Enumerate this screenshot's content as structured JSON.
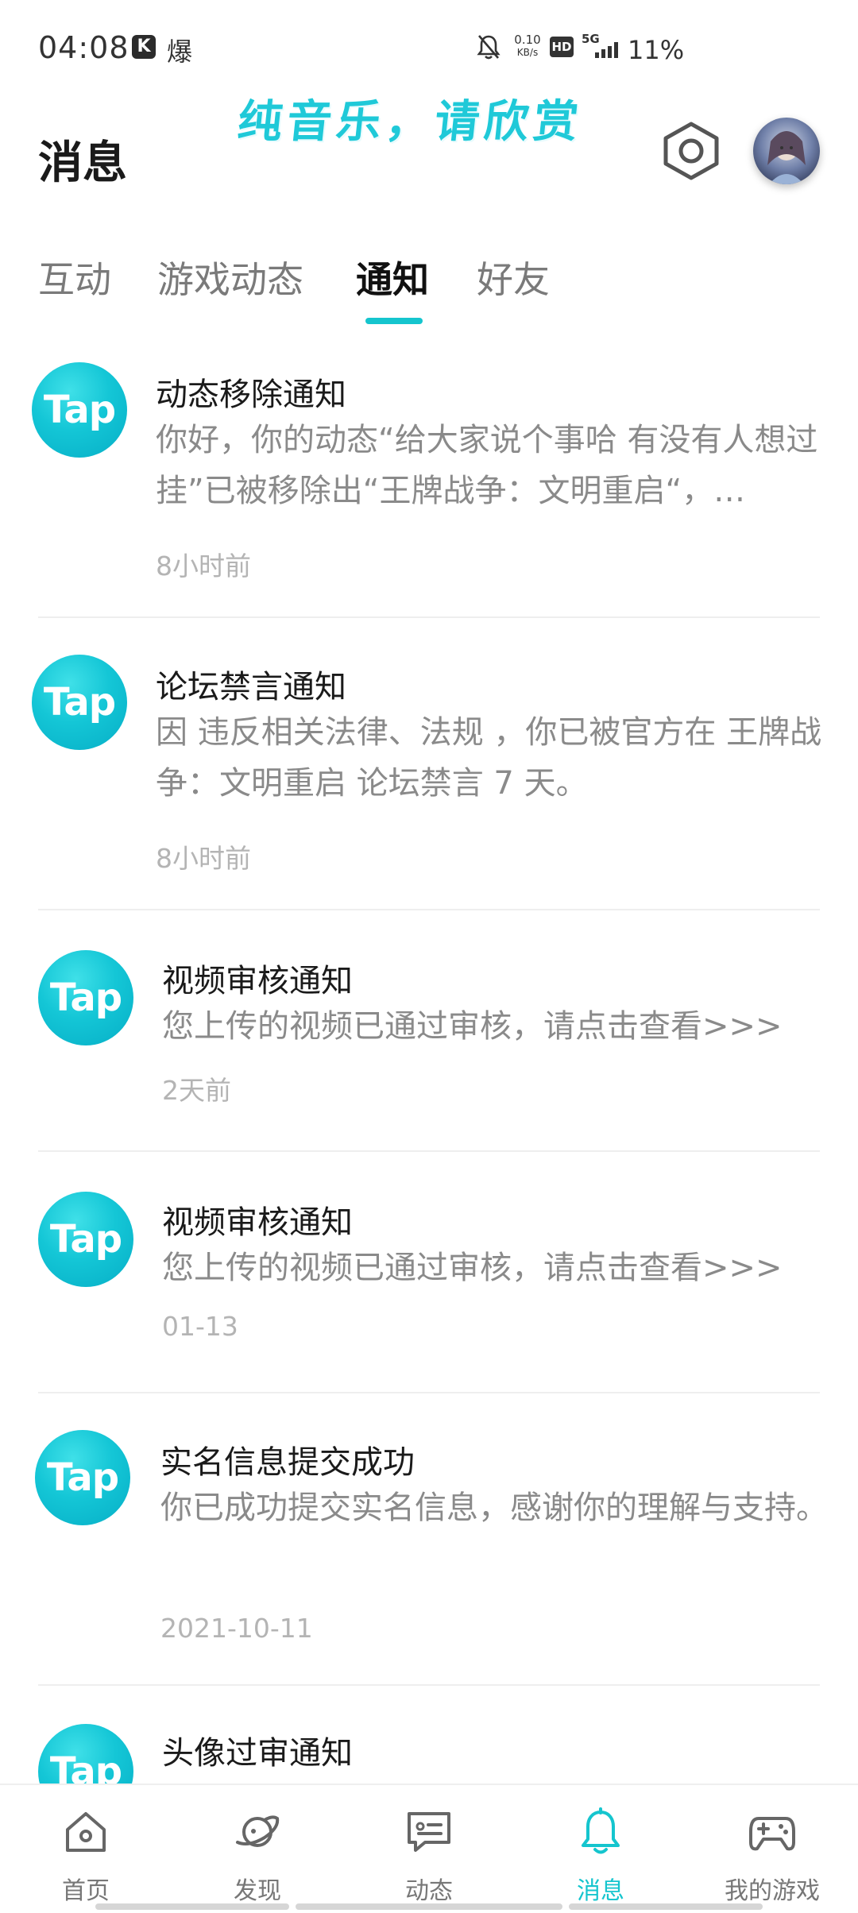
{
  "status_bar": {
    "time": "04:08",
    "app_icon_k": "K",
    "app_icon_2": "爆",
    "net_speed_value": "0.10",
    "net_speed_unit": "KB/s",
    "hd_badge": "HD",
    "network_type": "5G",
    "battery": "11%"
  },
  "overlay_caption": "纯音乐，请欣赏",
  "header": {
    "title": "消息"
  },
  "tabs": [
    {
      "label": "互动"
    },
    {
      "label": "游戏动态"
    },
    {
      "label": "通知"
    },
    {
      "label": "好友"
    }
  ],
  "active_tab_index": 2,
  "notifications": [
    {
      "logo": "Tap",
      "title": "动态移除通知",
      "body": "你好，你的动态“给大家说个事哈 有没有人想过挂”已被移除出“王牌战争：文明重启“，…",
      "time": "8小时前"
    },
    {
      "logo": "Tap",
      "title": "论坛禁言通知",
      "body": "因 违反相关法律、法规 ，你已被官方在 王牌战争：文明重启 论坛禁言 7 天。",
      "time": "8小时前"
    },
    {
      "logo": "Tap",
      "title": "视频审核通知",
      "body": "您上传的视频已通过审核，请点击查看>>>",
      "time": "2天前"
    },
    {
      "logo": "Tap",
      "title": "视频审核通知",
      "body": "您上传的视频已通过审核，请点击查看>>>",
      "time": "01-13"
    },
    {
      "logo": "Tap",
      "title": "实名信息提交成功",
      "body": "你已成功提交实名信息，感谢你的理解与支持。",
      "time": "2021-10-11"
    },
    {
      "logo": "Tap",
      "title": "头像过审通知",
      "body": "",
      "time": ""
    }
  ],
  "bottom_nav": [
    {
      "label": "首页",
      "icon": "home-icon"
    },
    {
      "label": "发现",
      "icon": "planet-icon"
    },
    {
      "label": "动态",
      "icon": "chat-icon"
    },
    {
      "label": "消息",
      "icon": "bell-icon"
    },
    {
      "label": "我的游戏",
      "icon": "gamepad-icon"
    }
  ],
  "colors": {
    "accent": "#15c5ce",
    "overlay_text": "#1fc9d8",
    "tap_logo": "#14c6d6"
  }
}
